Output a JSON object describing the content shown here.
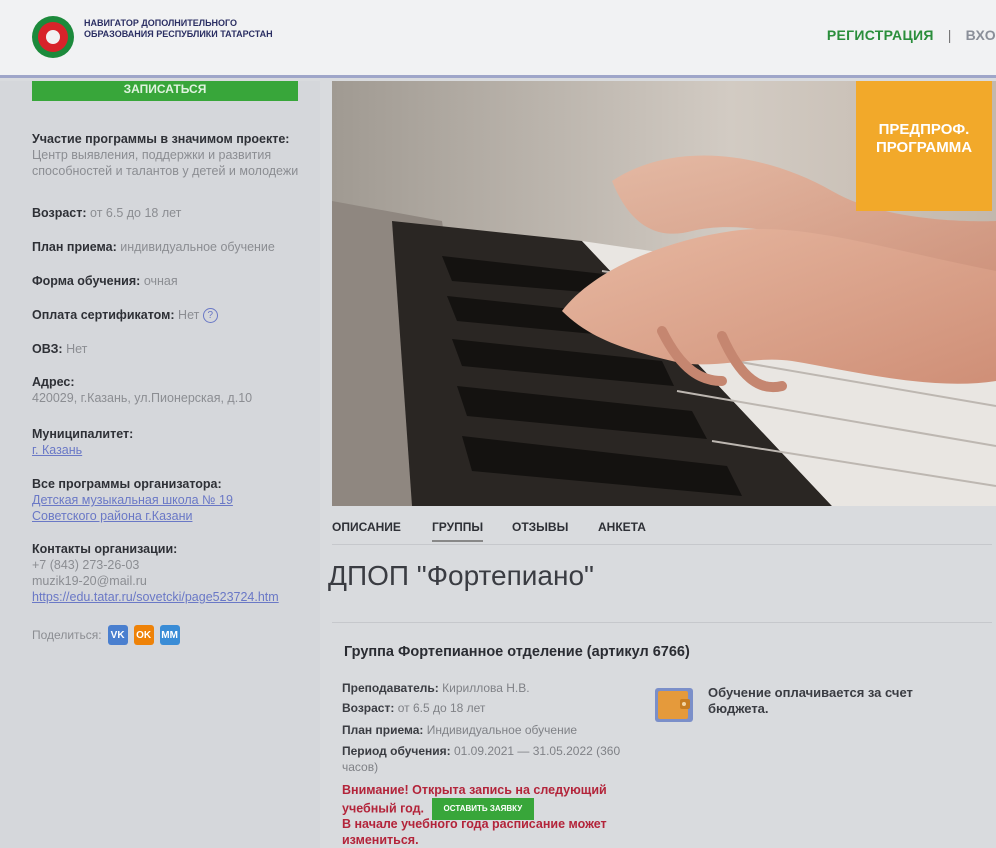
{
  "header": {
    "brand": "НАВИГАТОР ДОПОЛНИТЕЛЬНОГО ОБРАЗОВАНИЯ РЕСПУБЛИКИ ТАТАРСТАН",
    "register": "РЕГИСТРАЦИЯ",
    "separator": "|",
    "login": "ВХО"
  },
  "sidebar": {
    "enroll": "ЗАПИСАТЬСЯ",
    "project_label": "Участие программы в значимом проекте:",
    "project_value": "Центр выявления, поддержки и развития способностей и талантов у детей и молодежи",
    "age_label": "Возраст:",
    "age_value": "от 6.5 до 18 лет",
    "plan_label": "План приема:",
    "plan_value": "индивидуальное обучение",
    "form_label": "Форма обучения:",
    "form_value": "очная",
    "cert_label": "Оплата сертификатом:",
    "cert_value": "Нет",
    "ovz_label": "ОВЗ:",
    "ovz_value": "Нет",
    "address_label": "Адрес:",
    "address_value": "420029, г.Казань, ул.Пионерская, д.10",
    "municipality_label": "Муниципалитет:",
    "municipality_value": "г. Казань",
    "organizer_label": "Все программы организатора:",
    "organizer_value": "Детская музыкальная школа № 19 Советского района г.Казани",
    "contacts_label": "Контакты организации:",
    "phone": "+7 (843) 273-26-03",
    "email": "muzik19-20@mail.ru",
    "site": "https://edu.tatar.ru/sovetcki/page523724.htm",
    "share_label": "Поделиться:",
    "socials": [
      "VK",
      "OK",
      "MM"
    ]
  },
  "hero": {
    "badge_line1": "ПРЕДПРОФ.",
    "badge_line2": "ПРОГРАММА"
  },
  "tabs": [
    "ОПИСАНИЕ",
    "ГРУППЫ",
    "ОТЗЫВЫ",
    "АНКЕТА"
  ],
  "program_title": "ДПОП \"Фортепиано\"",
  "group": {
    "title": "Группа Фортепианное отделение (артикул 6766)",
    "teacher_label": "Преподаватель:",
    "teacher_value": "Кириллова Н.В.",
    "age_label": "Возраст:",
    "age_value": "от 6.5 до 18 лет",
    "plan_label": "План приема:",
    "plan_value": "Индивидуальное обучение",
    "period_label": "Период обучения:",
    "period_value": "01.09.2021 — 31.05.2022 (360 часов)",
    "warning1": "Внимание! Открыта запись на следующий учебный год.",
    "apply": "ОСТАВИТЬ ЗАЯВКУ",
    "warning2": "В начале учебного года расписание может измениться.",
    "budget": "Обучение оплачивается за счет бюджета."
  },
  "colors": {
    "green": "#38a63a",
    "orange": "#f2a92a",
    "link": "#6a78c6",
    "warning": "#b3243a"
  }
}
